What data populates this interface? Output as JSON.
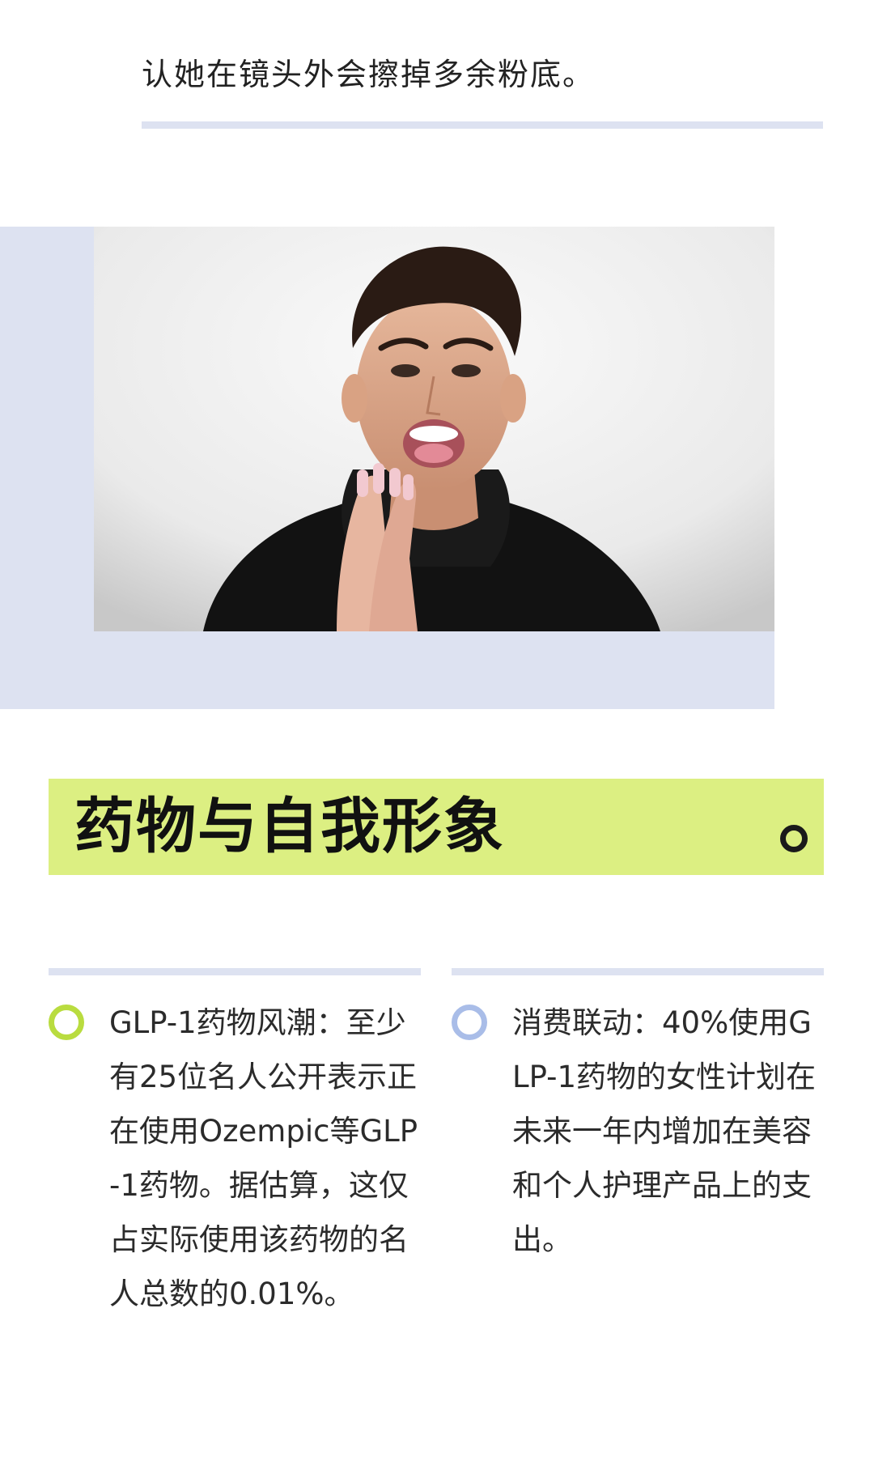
{
  "intro": {
    "text": "认她在镜头外会擦掉多余粉底。"
  },
  "section": {
    "title": "药物与自我形象"
  },
  "points": [
    {
      "text": "GLP-1药物风潮：至少有25位名人公开表示正在使用Ozempic等GLP-1药物。据估算，这仅占实际使用该药物的名人总数的0.01%。",
      "bullet_color": "#b9dc3f"
    },
    {
      "text": "消费联动：40%使用GLP-1药物的女性计划在未来一年内增加在美容和个人护理产品上的支出。",
      "bullet_color": "#a9bde8"
    }
  ],
  "colors": {
    "accent_green": "#dcef82",
    "accent_lavender": "#dde2f1"
  }
}
